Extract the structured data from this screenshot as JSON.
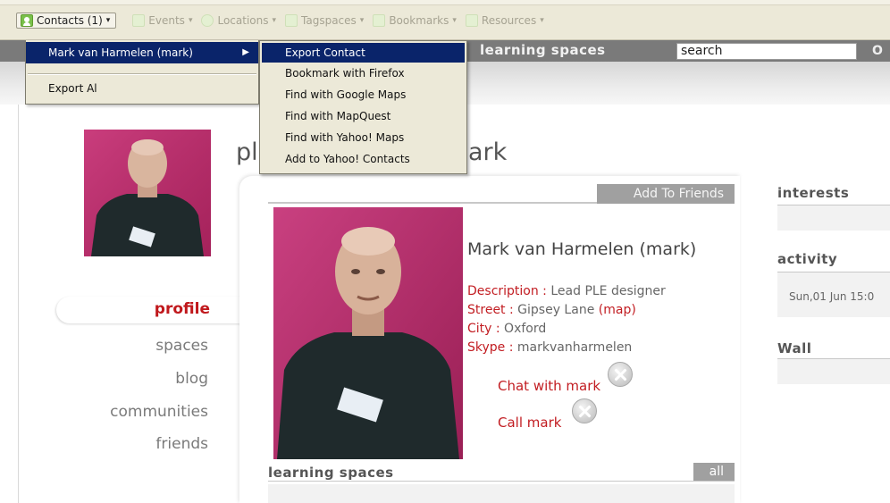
{
  "toolbar": {
    "items": [
      {
        "label": "Contacts (1)",
        "icon": "contacts-icon"
      },
      {
        "label": "Events",
        "icon": "events-icon"
      },
      {
        "label": "Locations",
        "icon": "locations-icon"
      },
      {
        "label": "Tagspaces",
        "icon": "tagspaces-icon"
      },
      {
        "label": "Bookmarks",
        "icon": "bookmarks-icon"
      },
      {
        "label": "Resources",
        "icon": "resources-icon"
      }
    ],
    "caret": "▾"
  },
  "contacts_menu": {
    "person": "Mark van Harmelen (mark)",
    "submenu_arrow": "▶",
    "export_all": "Export Al"
  },
  "contact_submenu": {
    "items": [
      "Export Contact",
      "Bookmark with Firefox",
      "Find with Google Maps",
      "Find with MapQuest",
      "Find with Yahoo! Maps",
      "Add to Yahoo! Contacts"
    ]
  },
  "header": {
    "site_title": "learning spaces",
    "search_value": "search",
    "go_label": "O"
  },
  "sidebar": {
    "active": "profile",
    "items": [
      "spaces",
      "blog",
      "communities",
      "friends"
    ]
  },
  "main": {
    "title_start": "pl",
    "title_end": "ark",
    "add_friends": "Add To Friends",
    "name": "Mark van Harmelen (mark)",
    "description_label": "Description :",
    "description_value": " Lead PLE designer",
    "street_label": "Street :",
    "street_value": " Gipsey Lane ",
    "map_link": "(map)",
    "city_label": "City :",
    "city_value": " Oxford",
    "skype_label": "Skype :",
    "skype_value": " markvanharmelen",
    "chat": "Chat with mark",
    "call": "Call mark",
    "learning_spaces": "learning spaces",
    "all": "all"
  },
  "right": {
    "interests": "interests",
    "activity": "activity",
    "activity_item": "Sun,01 Jun 15:0",
    "wall": "Wall"
  },
  "colors": {
    "accent_red": "#c21d22",
    "menu_highlight": "#0a246a",
    "header_grey": "#7a7a7a",
    "photo_backdrop": "#c02a6c"
  }
}
